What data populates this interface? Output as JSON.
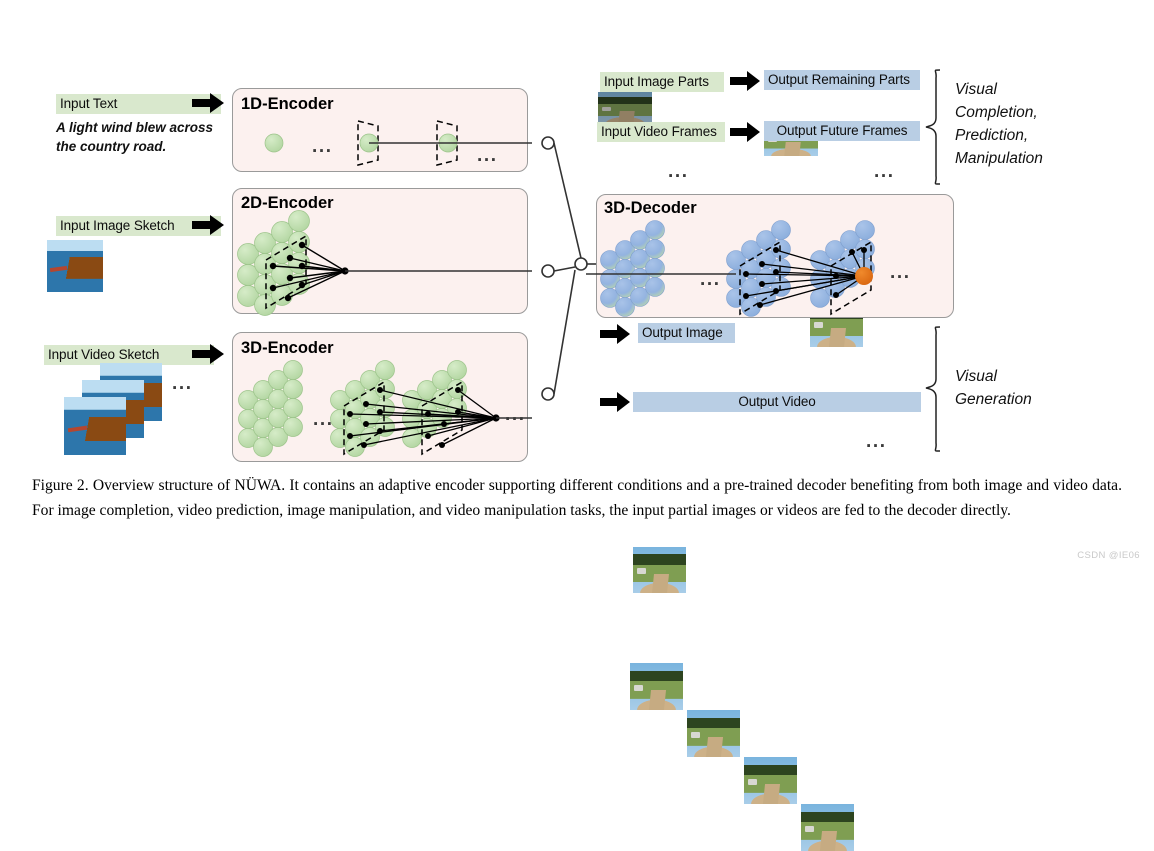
{
  "figure": {
    "caption": "Figure 2. Overview structure of NÜWA. It contains an adaptive encoder supporting different conditions and a pre-trained decoder benefiting from both image and video data. For image completion, video prediction, image manipulation, and video manipulation tasks, the input partial images or videos are fed to the decoder directly.",
    "watermark": "CSDN @IE06"
  },
  "colors": {
    "input_label_bg": "#d9e8cd",
    "output_label_bg": "#b9cee4",
    "panel_bg": "#fcf1ef",
    "panel_border": "#9a9a9a",
    "encoder_node": "#bcdcae",
    "decoder_node": "#93b3e0",
    "highlight_node": "#e2711d"
  },
  "inputs": [
    {
      "label": "Input Text",
      "sample_text_line1": "A light wind blew across",
      "sample_text_line2": "the country road."
    },
    {
      "label": "Input Image Sketch"
    },
    {
      "label": "Input Video Sketch",
      "ellipsis": "..."
    }
  ],
  "encoders": [
    {
      "title": "1D-Encoder",
      "ellipsis_left": "...",
      "ellipsis_right": "..."
    },
    {
      "title": "2D-Encoder"
    },
    {
      "title": "3D-Encoder",
      "ellipsis_left": "...",
      "ellipsis_right": "..."
    }
  ],
  "decoder": {
    "title": "3D-Decoder",
    "ellipsis_left": "...",
    "ellipsis_right": "..."
  },
  "top_right": {
    "rows": [
      {
        "input_label": "Input Image Parts",
        "output_label": "Output Remaining Parts"
      },
      {
        "input_label": "Input Video Frames",
        "output_label": "Output Future Frames",
        "input_ellipsis": "...",
        "output_ellipsis": "..."
      }
    ],
    "brace_label_line1": "Visual",
    "brace_label_line2": "Completion,",
    "brace_label_line3": "Prediction,",
    "brace_label_line4": "Manipulation"
  },
  "bottom_right": {
    "image_output_label": "Output Image",
    "video_output_label": "Output Video",
    "video_ellipsis": "...",
    "brace_label_line1": "Visual",
    "brace_label_line2": "Generation"
  }
}
